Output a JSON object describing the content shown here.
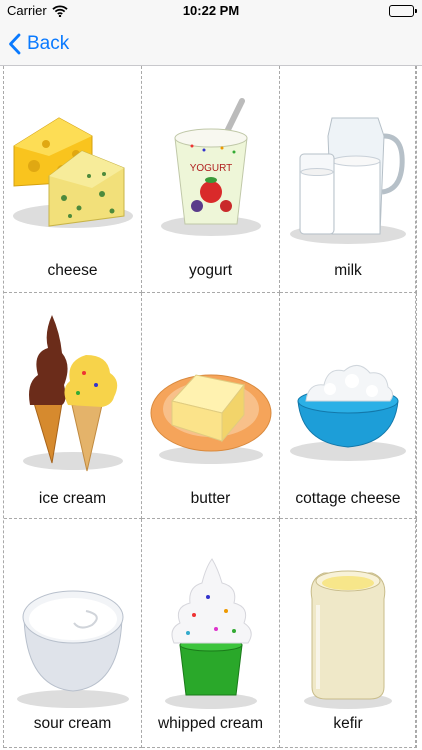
{
  "status_bar": {
    "carrier": "Carrier",
    "time": "10:22 PM"
  },
  "nav": {
    "back_label": "Back"
  },
  "cards": [
    {
      "label": "cheese",
      "icon": "cheese-icon"
    },
    {
      "label": "yogurt",
      "icon": "yogurt-icon",
      "package_text": "YOGURT"
    },
    {
      "label": "milk",
      "icon": "milk-icon"
    },
    {
      "label": "ice cream",
      "icon": "ice-cream-icon"
    },
    {
      "label": "butter",
      "icon": "butter-icon"
    },
    {
      "label": "cottage cheese",
      "icon": "cottage-cheese-icon"
    },
    {
      "label": "sour cream",
      "icon": "sour-cream-icon"
    },
    {
      "label": "whipped cream",
      "icon": "whipped-cream-icon"
    },
    {
      "label": "kefir",
      "icon": "kefir-icon"
    }
  ],
  "colors": {
    "accent": "#0a7aff",
    "grid_line": "#a9a9a9"
  }
}
